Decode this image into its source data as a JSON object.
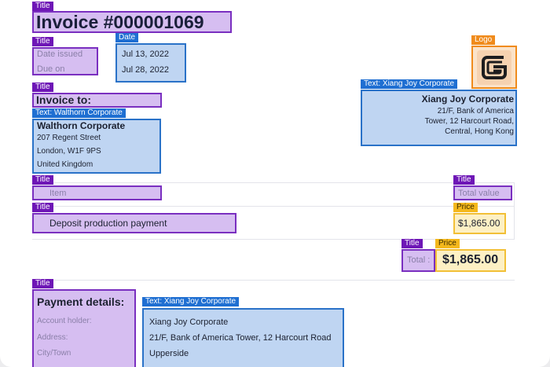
{
  "tags": {
    "title": "Title",
    "date": "Date",
    "logo": "Logo",
    "price": "Price",
    "text_recipient": "Text: Walthorn Corporate",
    "text_sender": "Text: Xiang Joy Corporate"
  },
  "invoice": {
    "title": "Invoice #000001069",
    "date_issued_label": "Date issued",
    "due_on_label": "Due on",
    "date_issued": "Jul 13, 2022",
    "due_on": "Jul 28, 2022",
    "invoice_to_label": "Invoice to:"
  },
  "recipient": {
    "name": "Walthorn Corporate",
    "address_line1": "207 Regent Street",
    "address_line2": "London, W1F 9PS",
    "address_line3": "United Kingdom"
  },
  "sender": {
    "name": "Xiang Joy Corporate",
    "address_line1": "21/F, Bank of America",
    "address_line2": "Tower, 12 Harcourt Road,",
    "address_line3": "Central, Hong Kong"
  },
  "table": {
    "col_item": "Item",
    "col_total_value": "Total value",
    "rows": [
      {
        "item": "Deposit production payment",
        "price": "$1,865.00"
      }
    ],
    "total_label": "Total :",
    "total_value": "$1,865.00"
  },
  "payment": {
    "title": "Payment details:",
    "account_holder_label": "Account holder:",
    "address_label": "Address:",
    "city_label": "City/Town",
    "account_holder": "Xiang Joy Corporate",
    "address": "21/F, Bank of America Tower, 12 Harcourt Road",
    "city": "Upperside"
  },
  "colors": {
    "title_tag": "#6e16b6",
    "text_tag": "#1f6fd2",
    "logo_tag": "#f08b1c",
    "price_tag": "#f4b81c"
  },
  "logo": {
    "icon": "g-logo-icon"
  }
}
